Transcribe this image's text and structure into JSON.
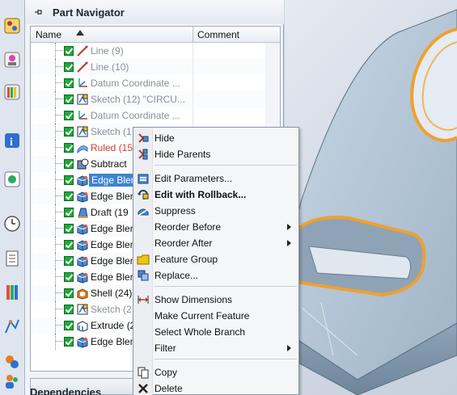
{
  "navigator": {
    "title": "Part Navigator",
    "columns": {
      "name": "Name",
      "comment": "Comment"
    },
    "rows": [
      {
        "label": "Line (9)",
        "icon": "line-icon",
        "style": "grey"
      },
      {
        "label": "Line (10)",
        "icon": "line-icon",
        "style": "grey"
      },
      {
        "label": "Datum Coordinate ...",
        "icon": "datum-csys-icon",
        "style": "grey"
      },
      {
        "label": "Sketch (12) \"CIRCU...",
        "icon": "sketch-icon",
        "style": "grey"
      },
      {
        "label": "Datum Coordinate ...",
        "icon": "datum-csys-icon",
        "style": "grey"
      },
      {
        "label": "Sketch (1",
        "icon": "sketch-icon",
        "style": "grey"
      },
      {
        "label": "Ruled (15",
        "icon": "ruled-icon",
        "style": "red"
      },
      {
        "label": "Subtract",
        "icon": "subtract-icon",
        "style": "black"
      },
      {
        "label": "Edge Blen",
        "icon": "edge-blend-icon",
        "style": "selected"
      },
      {
        "label": "Edge Blen",
        "icon": "edge-blend-icon",
        "style": "black"
      },
      {
        "label": "Draft (19",
        "icon": "draft-icon",
        "style": "black"
      },
      {
        "label": "Edge Blen",
        "icon": "edge-blend-icon",
        "style": "black"
      },
      {
        "label": "Edge Blen",
        "icon": "edge-blend-icon",
        "style": "black"
      },
      {
        "label": "Edge Blen",
        "icon": "edge-blend-icon",
        "style": "black"
      },
      {
        "label": "Edge Blen",
        "icon": "edge-blend-icon",
        "style": "black"
      },
      {
        "label": "Shell (24)",
        "icon": "shell-icon",
        "style": "black"
      },
      {
        "label": "Sketch (2",
        "icon": "sketch-icon",
        "style": "grey"
      },
      {
        "label": "Extrude (2",
        "icon": "extrude-icon",
        "style": "black"
      },
      {
        "label": "Edge Blen",
        "icon": "edge-blend-icon",
        "style": "black"
      }
    ],
    "dependencies_label": "Dependencies"
  },
  "context_menu": {
    "items": [
      {
        "label": "Hide",
        "icon": "hide-icon",
        "bold": false,
        "submenu": false
      },
      {
        "label": "Hide Parents",
        "icon": "hide-parents-icon",
        "bold": false,
        "submenu": false
      },
      {
        "label": "Edit Parameters...",
        "icon": "edit-parameters-icon",
        "bold": false,
        "submenu": false
      },
      {
        "label": "Edit with Rollback...",
        "icon": "edit-rollback-icon",
        "bold": true,
        "submenu": false
      },
      {
        "label": "Suppress",
        "icon": "suppress-icon",
        "bold": false,
        "submenu": false
      },
      {
        "label": "Reorder Before",
        "icon": "",
        "bold": false,
        "submenu": true
      },
      {
        "label": "Reorder After",
        "icon": "",
        "bold": false,
        "submenu": true
      },
      {
        "label": "Feature Group",
        "icon": "feature-group-icon",
        "bold": false,
        "submenu": false
      },
      {
        "label": "Replace...",
        "icon": "replace-icon",
        "bold": false,
        "submenu": false
      },
      {
        "label": "Show Dimensions",
        "icon": "show-dimensions-icon",
        "bold": false,
        "submenu": false
      },
      {
        "label": "Make Current Feature",
        "icon": "",
        "bold": false,
        "submenu": false
      },
      {
        "label": "Select Whole Branch",
        "icon": "",
        "bold": false,
        "submenu": false
      },
      {
        "label": "Filter",
        "icon": "",
        "bold": false,
        "submenu": true
      },
      {
        "label": "Copy",
        "icon": "copy-icon",
        "bold": false,
        "submenu": false
      },
      {
        "label": "Delete",
        "icon": "delete-icon",
        "bold": false,
        "submenu": false
      }
    ]
  },
  "resource_bar": {
    "icons": [
      "assembly-navigator-icon",
      "constraint-navigator-icon",
      "part-navigator-icon",
      "reuse-library-icon",
      "hd3d-tools-icon",
      "web-browser-icon",
      "history-icon",
      "system-materials-icon",
      "process-studio-icon",
      "manufacturing-wizard-icon",
      "roles-icon"
    ]
  },
  "colors": {
    "selection": "#3f82d4",
    "check": "#1fa83a",
    "highlight_edge": "#f0a030",
    "part_face": "#b7c9d9"
  }
}
